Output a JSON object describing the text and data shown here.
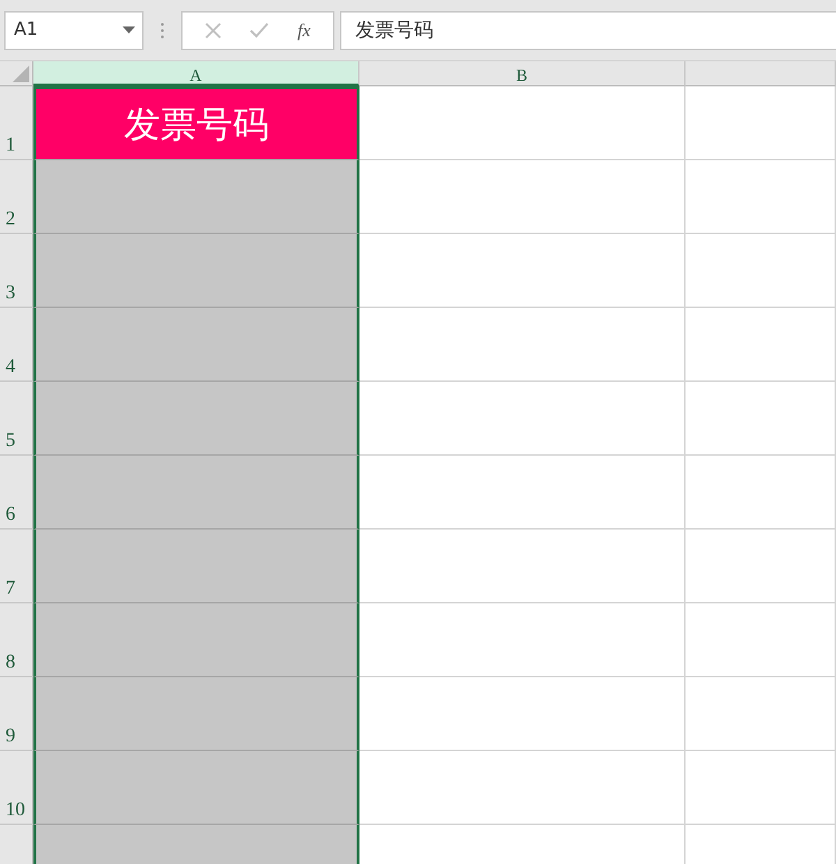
{
  "name_box": "A1",
  "formula_bar": {
    "fx": "fx",
    "value": "发票号码"
  },
  "columns": [
    {
      "label": "A",
      "selected": true
    },
    {
      "label": "B",
      "selected": false
    }
  ],
  "rows": [
    {
      "label": "1",
      "cells": [
        {
          "value": "发票号码",
          "kind": "title"
        }
      ]
    },
    {
      "label": "2",
      "cells": []
    },
    {
      "label": "3",
      "cells": []
    },
    {
      "label": "4",
      "cells": []
    },
    {
      "label": "5",
      "cells": []
    },
    {
      "label": "6",
      "cells": []
    },
    {
      "label": "7",
      "cells": []
    },
    {
      "label": "8",
      "cells": []
    },
    {
      "label": "9",
      "cells": []
    },
    {
      "label": "10",
      "cells": []
    }
  ]
}
